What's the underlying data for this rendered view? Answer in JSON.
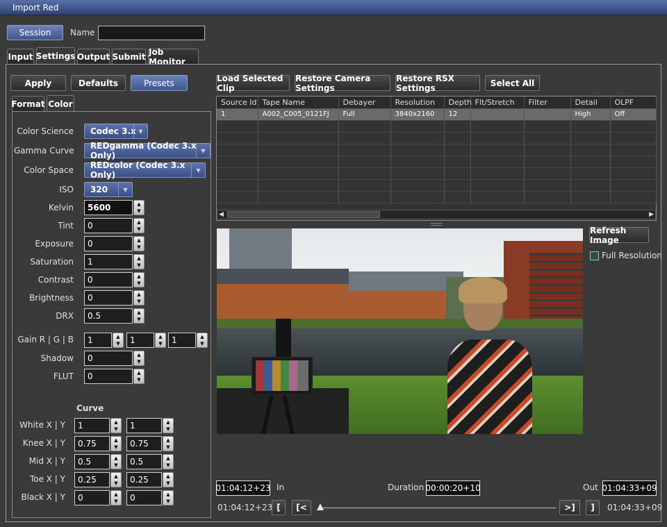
{
  "window": {
    "title": "Import Red"
  },
  "session": {
    "button": "Session",
    "name_label": "Name",
    "name_value": ""
  },
  "main_tabs": [
    "Input",
    "Settings",
    "Output",
    "Submit",
    "Job Monitor"
  ],
  "left_buttons": {
    "apply": "Apply",
    "defaults": "Defaults",
    "presets": "Presets"
  },
  "sub_tabs": [
    "Format",
    "Color"
  ],
  "color": {
    "color_science": {
      "label": "Color Science",
      "value": "Codec 3.x"
    },
    "gamma_curve": {
      "label": "Gamma Curve",
      "value": "REDgamma (Codec 3.x Only)"
    },
    "color_space": {
      "label": "Color Space",
      "value": "REDcolor (Codec 3.x Only)"
    },
    "iso": {
      "label": "ISO",
      "value": "320"
    },
    "kelvin": {
      "label": "Kelvin",
      "value": "5600"
    },
    "tint": {
      "label": "Tint",
      "value": "0"
    },
    "exposure": {
      "label": "Exposure",
      "value": "0"
    },
    "saturation": {
      "label": "Saturation",
      "value": "1"
    },
    "contrast": {
      "label": "Contrast",
      "value": "0"
    },
    "brightness": {
      "label": "Brightness",
      "value": "0"
    },
    "drx": {
      "label": "DRX",
      "value": "0.5"
    },
    "gain": {
      "label": "Gain R | G | B",
      "r": "1",
      "g": "1",
      "b": "1"
    },
    "shadow": {
      "label": "Shadow",
      "value": "0"
    },
    "flut": {
      "label": "FLUT",
      "value": "0"
    }
  },
  "curve": {
    "title": "Curve",
    "white": {
      "label": "White X | Y",
      "x": "1",
      "y": "1"
    },
    "knee": {
      "label": "Knee X | Y",
      "x": "0.75",
      "y": "0.75"
    },
    "mid": {
      "label": "Mid X | Y",
      "x": "0.5",
      "y": "0.5"
    },
    "toe": {
      "label": "Toe X | Y",
      "x": "0.25",
      "y": "0.25"
    },
    "black": {
      "label": "Black X | Y",
      "x": "0",
      "y": "0"
    }
  },
  "toolbar": {
    "load": "Load Selected Clip",
    "restore_camera": "Restore Camera Settings",
    "restore_rsx": "Restore RSX Settings",
    "select_all": "Select All"
  },
  "clip_table": {
    "columns": [
      "Source Id",
      "Tape Name",
      "Debayer",
      "Resolution",
      "Depth",
      "Flt/Stretch",
      "Filter",
      "Detail",
      "OLPF"
    ],
    "rows": [
      [
        "1",
        "A002_C005_0121FJ",
        "Full",
        "3840x2160",
        "12",
        "",
        "",
        "High",
        "Off"
      ]
    ]
  },
  "preview": {
    "refresh": "Refresh Image",
    "full_resolution": "Full Resolution",
    "full_resolution_checked": false
  },
  "timecode": {
    "in_value": "01:04:12+23",
    "in_label": "In",
    "duration_label": "Duration",
    "duration_value": "00:00:20+10",
    "out_label": "Out",
    "out_value": "01:04:33+09",
    "current_in": "01:04:12+23",
    "current_out": "01:04:33+09",
    "mark_in_btn": "[",
    "prev_btn": "[<",
    "next_btn": ">]",
    "mark_out_btn": "]",
    "position": 0
  }
}
